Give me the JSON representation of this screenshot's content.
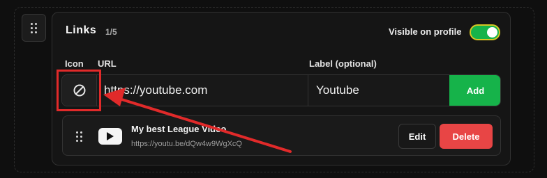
{
  "links_section": {
    "title": "Links",
    "count": "1/5",
    "visibility": {
      "label": "Visible on profile",
      "enabled": true
    }
  },
  "form": {
    "columns": {
      "icon": "Icon",
      "url": "URL",
      "label": "Label (optional)"
    },
    "icon": "no-icon-selected",
    "url_value": "https://youtube.com",
    "label_value": "Youtube",
    "add_label": "Add"
  },
  "links": [
    {
      "icon": "youtube-icon",
      "title": "My best League Video",
      "url": "https://youtu.be/dQw4w9WgXcQ",
      "edit_label": "Edit",
      "delete_label": "Delete"
    }
  ],
  "colors": {
    "accent_green": "#16b34a",
    "delete_red": "#e84545",
    "annotation_red": "#e12a2a",
    "toggle_border": "#d6c623"
  }
}
